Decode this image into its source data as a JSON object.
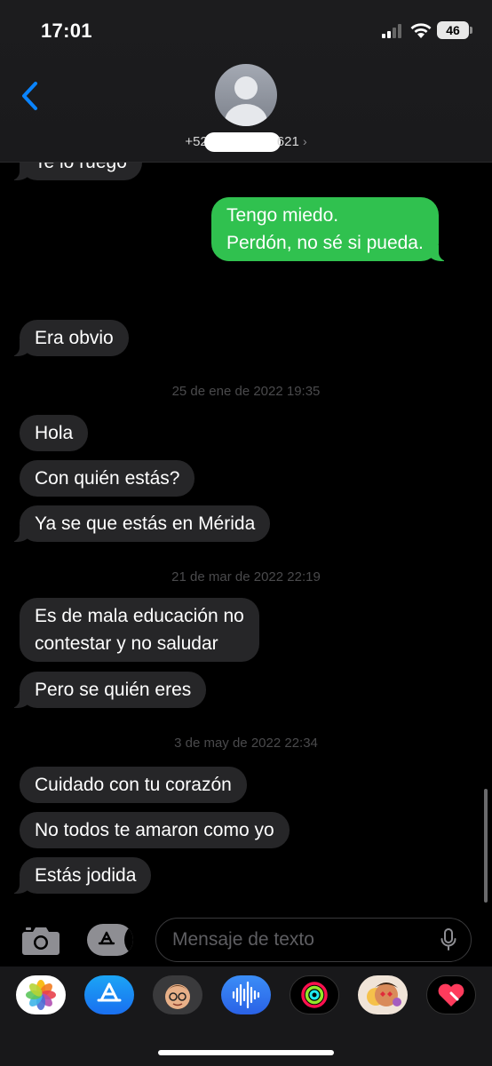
{
  "status": {
    "time": "17:01",
    "battery": "46"
  },
  "contact": {
    "number_prefix": "+52",
    "number_suffix": "621"
  },
  "messages": {
    "m0": "Te lo ruego",
    "m1": "Tengo miedo.\nPerdón, no sé si pueda.",
    "m2": "Era obvio",
    "m3": "Hola",
    "m4": "Con quién estás?",
    "m5": "Ya se que estás en Mérida",
    "m6": "Es de mala educación no\ncontestar y no saludar",
    "m7": "Pero se quién eres",
    "m8": "Cuidado con tu corazón",
    "m9": "No todos te amaron como yo",
    "m10": "Estás jodida"
  },
  "timestamps": {
    "t1": "25 de ene de 2022 19:35",
    "t2": "21 de mar de 2022 22:19",
    "t3": "3 de may de 2022 22:34"
  },
  "composer": {
    "placeholder": "Mensaje de texto"
  },
  "app_drawer": [
    "photos-icon",
    "app-store-icon",
    "memoji-icon",
    "audio-icon",
    "activity-icon",
    "memoji-stickers-icon",
    "digital-touch-icon"
  ],
  "colors": {
    "outgoing": "#30c14f",
    "incoming": "#262628",
    "accent": "#0a84ff"
  }
}
